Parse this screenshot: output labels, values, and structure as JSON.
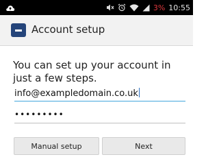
{
  "status_bar": {
    "left_icon": "upload-cloud-icon",
    "icons": [
      "mute-icon",
      "alarm-icon",
      "wifi-icon",
      "signal-icon"
    ],
    "battery": "3%",
    "time": "10:55",
    "battery_color": "#e0393e"
  },
  "app_bar": {
    "icon": "email-app-icon",
    "title": "Account setup",
    "icon_color": "#24447a"
  },
  "main": {
    "intro": "You can set up your account in just a few steps.",
    "email_value": "info@exampledomain.co.uk",
    "password_value": "•••••••••",
    "focus_color": "#42a6dd"
  },
  "buttons": {
    "manual_setup": "Manual setup",
    "next": "Next"
  }
}
